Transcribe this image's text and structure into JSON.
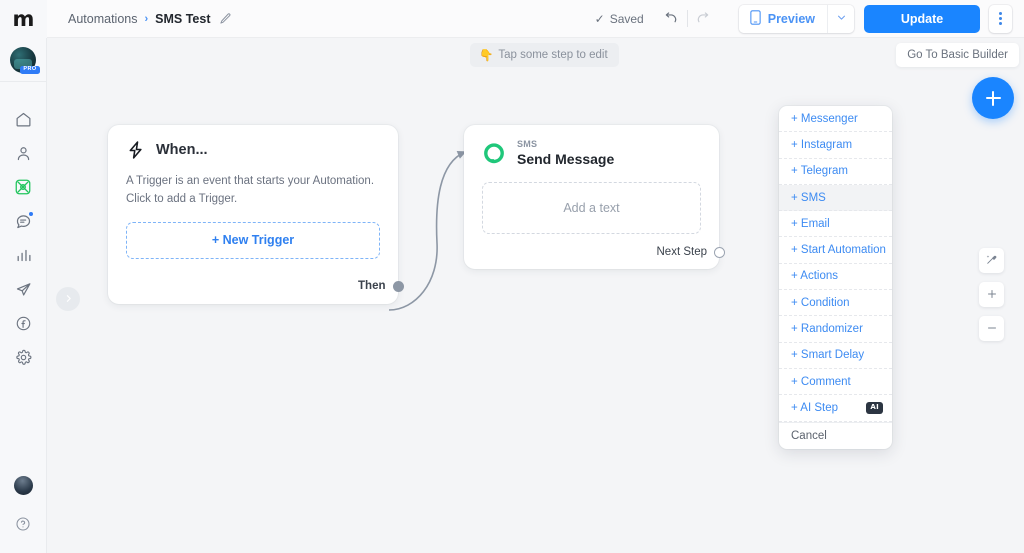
{
  "sidebar": {
    "logo": "m",
    "account": {
      "pro_badge": "PRO"
    },
    "items": [
      {
        "icon": "home-icon",
        "label": "Home"
      },
      {
        "icon": "contacts-icon",
        "label": "Contacts"
      },
      {
        "icon": "automations-icon",
        "label": "Automations"
      },
      {
        "icon": "live-chat-icon",
        "label": "Live Chat"
      },
      {
        "icon": "analytics-icon",
        "label": "Analytics"
      },
      {
        "icon": "broadcast-icon",
        "label": "Broadcasting"
      },
      {
        "icon": "facebook-icon",
        "label": "Facebook"
      },
      {
        "icon": "settings-gear-icon",
        "label": "Settings"
      }
    ],
    "bottom": [
      {
        "icon": "user-avatar",
        "label": "Profile"
      },
      {
        "icon": "help-question-icon",
        "label": "Help"
      }
    ]
  },
  "topbar": {
    "breadcrumb": {
      "parent": "Automations",
      "separator": "›",
      "current": "SMS Test"
    },
    "saved_label": "Saved",
    "undo_label": "Undo",
    "redo_label": "Redo",
    "preview_label": "Preview",
    "update_label": "Update",
    "more_label": "More options"
  },
  "canvas": {
    "hint": {
      "emoji": "👇",
      "text": "Tap some step to edit"
    },
    "basic_builder_label": "Go To Basic Builder",
    "add_step_label": "+",
    "controls": [
      {
        "icon": "magic-wand-icon",
        "label": "Auto layout"
      },
      {
        "icon": "plus-icon",
        "label": "Zoom in"
      },
      {
        "icon": "minus-icon",
        "label": "Zoom out"
      }
    ],
    "collapse_label": "›"
  },
  "trigger_card": {
    "icon": "lightning-bolt-icon",
    "title": "When...",
    "description_line1": "A Trigger is an event that starts your Automation.",
    "description_line2": "Click to add a Trigger.",
    "new_trigger_label": "+ New Trigger",
    "then_label": "Then"
  },
  "sms_card": {
    "icon": "sms-bubble-icon",
    "kicker": "SMS",
    "title": "Send Message",
    "placeholder": "Add a text",
    "next_step_label": "Next Step"
  },
  "step_menu": {
    "items": [
      {
        "label": "+ Messenger",
        "active": false,
        "badge": null
      },
      {
        "label": "+ Instagram",
        "active": false,
        "badge": null
      },
      {
        "label": "+ Telegram",
        "active": false,
        "badge": null
      },
      {
        "label": "+ SMS",
        "active": true,
        "badge": null
      },
      {
        "label": "+ Email",
        "active": false,
        "badge": null
      },
      {
        "label": "+ Start Automation",
        "active": false,
        "badge": null
      },
      {
        "label": "+ Actions",
        "active": false,
        "badge": null
      },
      {
        "label": "+ Condition",
        "active": false,
        "badge": null
      },
      {
        "label": "+ Randomizer",
        "active": false,
        "badge": null
      },
      {
        "label": "+ Smart Delay",
        "active": false,
        "badge": null
      },
      {
        "label": "+ Comment",
        "active": false,
        "badge": null
      },
      {
        "label": "+ AI Step",
        "active": false,
        "badge": "AI"
      }
    ],
    "cancel_label": "Cancel"
  },
  "colors": {
    "accent_blue": "#1a85ff",
    "link_blue": "#3d8bf2",
    "sms_green": "#1fc77a",
    "canvas_bg": "#f4f5f7"
  }
}
